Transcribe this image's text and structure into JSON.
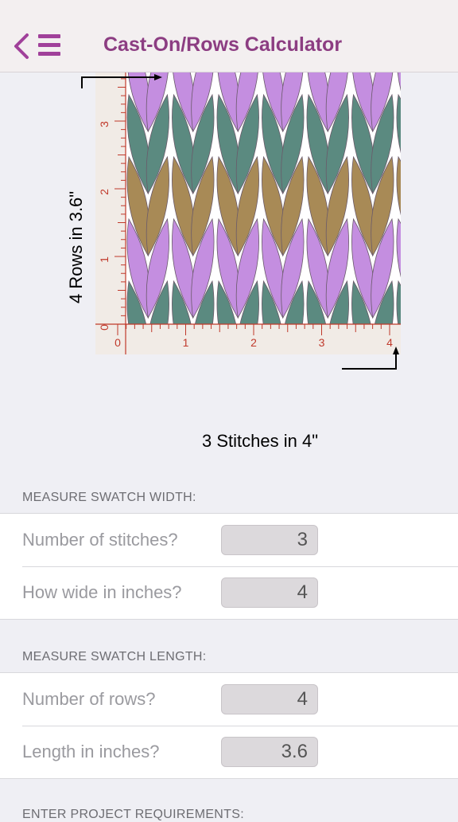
{
  "header": {
    "title": "Cast-On/Rows Calculator",
    "back_icon": "chevron-left-icon",
    "menu_icon": "hamburger-menu-icon",
    "accent_color": "#a0409a"
  },
  "swatch": {
    "rows_label": "4 Rows in 3.6\"",
    "stitches_label": "3 Stitches in 4\"",
    "ruler_x_ticks": [
      "0",
      "1",
      "2",
      "3",
      "4"
    ],
    "ruler_y_ticks": [
      "0",
      "1",
      "2",
      "3"
    ],
    "ruler_color": "#c0392b",
    "colors": {
      "purple": "#c48ee0",
      "green": "#5b8a80",
      "brown": "#a88a56"
    }
  },
  "width_section": {
    "header": "MEASURE SWATCH WIDTH:",
    "stitches_label": "Number of stitches?",
    "stitches_value": "3",
    "width_label": "How wide in inches?",
    "width_value": "4"
  },
  "length_section": {
    "header": "MEASURE SWATCH LENGTH:",
    "rows_label": "Number of rows?",
    "rows_value": "4",
    "length_label": "Length in inches?",
    "length_value": "3.6"
  },
  "project_section": {
    "header": "ENTER PROJECT REQUIREMENTS:"
  }
}
